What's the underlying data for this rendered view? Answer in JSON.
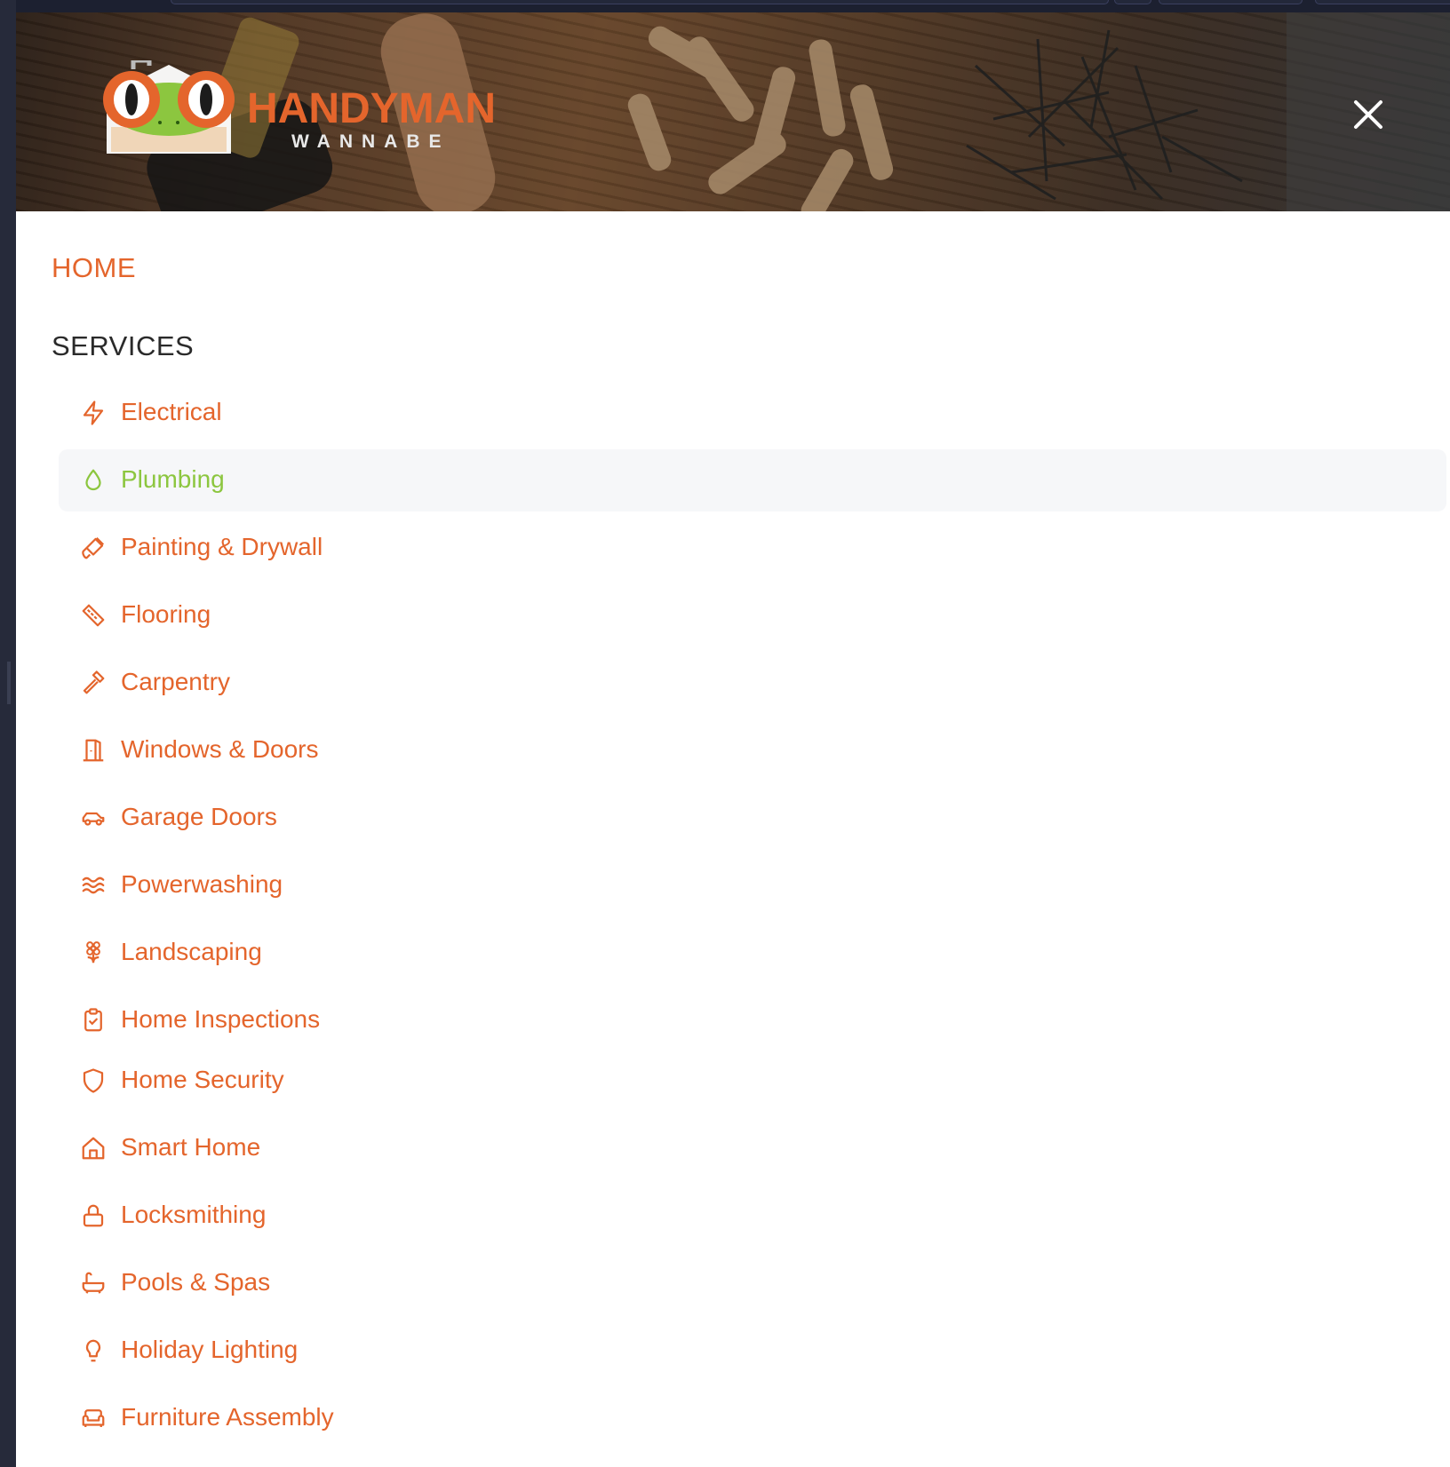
{
  "brand": {
    "name_top": "HANDYMAN",
    "name_bottom": "WANNABE"
  },
  "header": {
    "close_icon": "close-icon"
  },
  "menu": {
    "home_label": "HOME",
    "services_heading": "SERVICES",
    "services": [
      {
        "label": "Electrical",
        "icon": "lightning-icon",
        "active": false
      },
      {
        "label": "Plumbing",
        "icon": "water-drop-icon",
        "active": true
      },
      {
        "label": "Painting & Drywall",
        "icon": "paintbrush-icon",
        "active": false
      },
      {
        "label": "Flooring",
        "icon": "ruler-icon",
        "active": false
      },
      {
        "label": "Carpentry",
        "icon": "hammer-icon",
        "active": false
      },
      {
        "label": "Windows & Doors",
        "icon": "door-icon",
        "active": false
      },
      {
        "label": "Garage Doors",
        "icon": "car-icon",
        "active": false
      },
      {
        "label": "Powerwashing",
        "icon": "waves-icon",
        "active": false
      },
      {
        "label": "Landscaping",
        "icon": "flower-icon",
        "active": false
      },
      {
        "label": "Home Inspections",
        "icon": "clipboard-check-icon",
        "active": false
      },
      {
        "label": "Home Security",
        "icon": "shield-icon",
        "active": false
      },
      {
        "label": "Smart Home",
        "icon": "house-icon",
        "active": false
      },
      {
        "label": "Locksmithing",
        "icon": "lock-icon",
        "active": false
      },
      {
        "label": "Pools & Spas",
        "icon": "bathtub-icon",
        "active": false
      },
      {
        "label": "Holiday Lighting",
        "icon": "lightbulb-icon",
        "active": false
      },
      {
        "label": "Furniture Assembly",
        "icon": "sofa-icon",
        "active": false
      }
    ]
  },
  "colors": {
    "accent": "#e4652c",
    "active": "#8cc63f",
    "heading": "#2a2a2a",
    "active_row_bg": "#f6f7f9"
  }
}
